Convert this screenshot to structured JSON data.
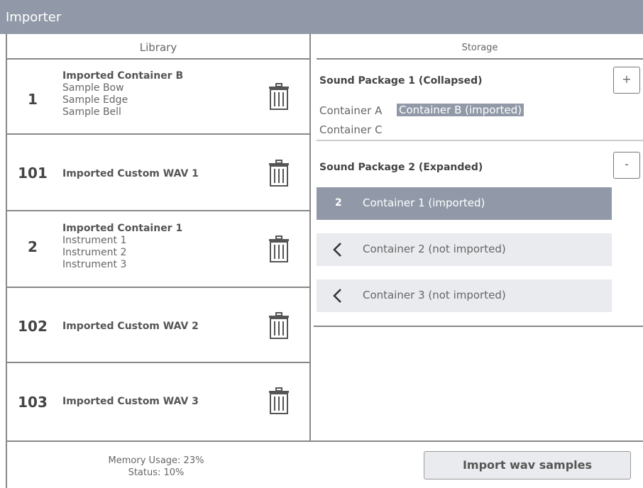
{
  "window": {
    "title": "Importer"
  },
  "library": {
    "header": "Library",
    "items": [
      {
        "number": "1",
        "title": "Imported Container B",
        "subitems": [
          "Sample Bow",
          "Sample Edge",
          "Sample Bell"
        ]
      },
      {
        "number": "101",
        "title": "Imported Custom WAV 1",
        "subitems": []
      },
      {
        "number": "2",
        "title": "Imported Container 1",
        "subitems": [
          "Instrument 1",
          "Instrument 2",
          "Instrument 3"
        ]
      },
      {
        "number": "102",
        "title": "Imported Custom WAV 2",
        "subitems": []
      },
      {
        "number": "103",
        "title": "Imported Custom WAV 3",
        "subitems": []
      }
    ],
    "trash_icon": "trash-icon"
  },
  "storage": {
    "header": "Storage",
    "packages": [
      {
        "title": "Sound Package 1 (Collapsed)",
        "toggle": "+",
        "containers": [
          "Container A",
          "Container B (imported)",
          "Container C"
        ],
        "highlighted": "Container B (imported)"
      },
      {
        "title": "Sound Package 2 (Expanded)",
        "toggle": "-",
        "containers": [
          {
            "badge": "2",
            "label": "Container 1 (imported)",
            "state": "imported"
          },
          {
            "icon": "chevron-left-icon",
            "label": "Container 2 (not imported)",
            "state": "not-imported"
          },
          {
            "icon": "chevron-left-icon",
            "label": "Container 3 (not imported)",
            "state": "not-imported"
          }
        ]
      }
    ]
  },
  "footer": {
    "memory": "Memory Usage: 23%",
    "status": "Status: 10%",
    "import_button": "Import wav samples"
  },
  "colors": {
    "accent": "#9199a8",
    "row_light": "#e9ebee",
    "border": "#888888"
  }
}
